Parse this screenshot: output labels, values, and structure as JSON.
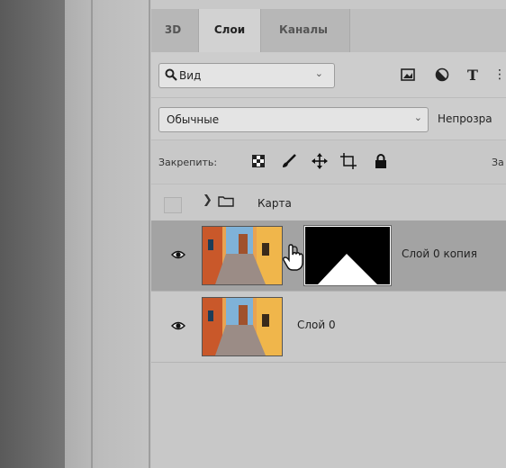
{
  "tabs": [
    "3D",
    "Слои",
    "Каналы"
  ],
  "filter": {
    "kind_label": "Вид",
    "icons": [
      "image-filter-icon",
      "adjustment-filter-icon",
      "type-filter-icon"
    ]
  },
  "blend": {
    "mode": "Обычные",
    "opacity_label": "Непрозра"
  },
  "lock": {
    "label": "Закрепить:",
    "icons": [
      "lock-transparent-icon",
      "lock-paint-icon",
      "lock-position-icon",
      "lock-artboard-icon",
      "lock-all-icon"
    ],
    "fill_trunc": "За"
  },
  "layers": {
    "group": {
      "name": "Карта"
    },
    "items": [
      {
        "name": "Слой 0 копия",
        "selected": true,
        "has_mask": true
      },
      {
        "name": "Слой 0",
        "selected": false,
        "has_mask": false
      }
    ]
  },
  "colors": {
    "panel_bg": "#c8c8c8",
    "selected_row": "#a3a3a3",
    "mask_black": "#000000",
    "mask_white": "#ffffff"
  }
}
